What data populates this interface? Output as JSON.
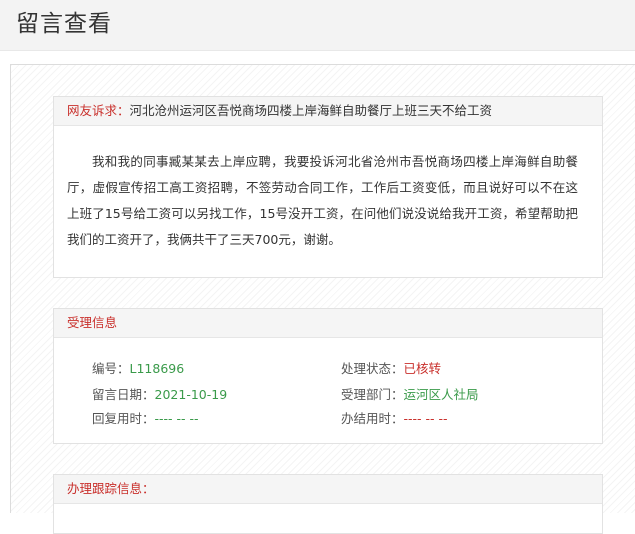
{
  "page": {
    "title": "留言查看"
  },
  "complaint": {
    "label": "网友诉求：",
    "title": "河北沧州运河区吾悦商场四楼上岸海鲜自助餐厅上班三天不给工资",
    "body": "我和我的同事臧某某去上岸应聘，我要投诉河北省沧州市吾悦商场四楼上岸海鲜自助餐厅，虚假宣传招工高工资招聘，不签劳动合同工作，工作后工资变低，而且说好可以不在这上班了15号给工资可以另找工作，15号没开工资，在问他们说没说给我开工资，希望帮助把我们的工资开了，我俩共干了三天700元，谢谢。"
  },
  "acceptance": {
    "header": "受理信息",
    "fields": [
      {
        "label": "编号：",
        "value": "L118696"
      },
      {
        "label": "处理状态：",
        "value": "已核转"
      },
      {
        "label": "留言日期：",
        "value": "2021-10-19"
      },
      {
        "label": "受理部门：",
        "value": "运河区人社局"
      },
      {
        "label": "回复用时：",
        "value": "---- -- --"
      },
      {
        "label": "办结用时：",
        "value": "---- -- --"
      }
    ]
  },
  "tracking": {
    "header": "办理跟踪信息："
  },
  "colors": {
    "accent_red": "#c9302c",
    "value_green": "#3a9a4a",
    "header_bg": "#f3f3f3"
  }
}
